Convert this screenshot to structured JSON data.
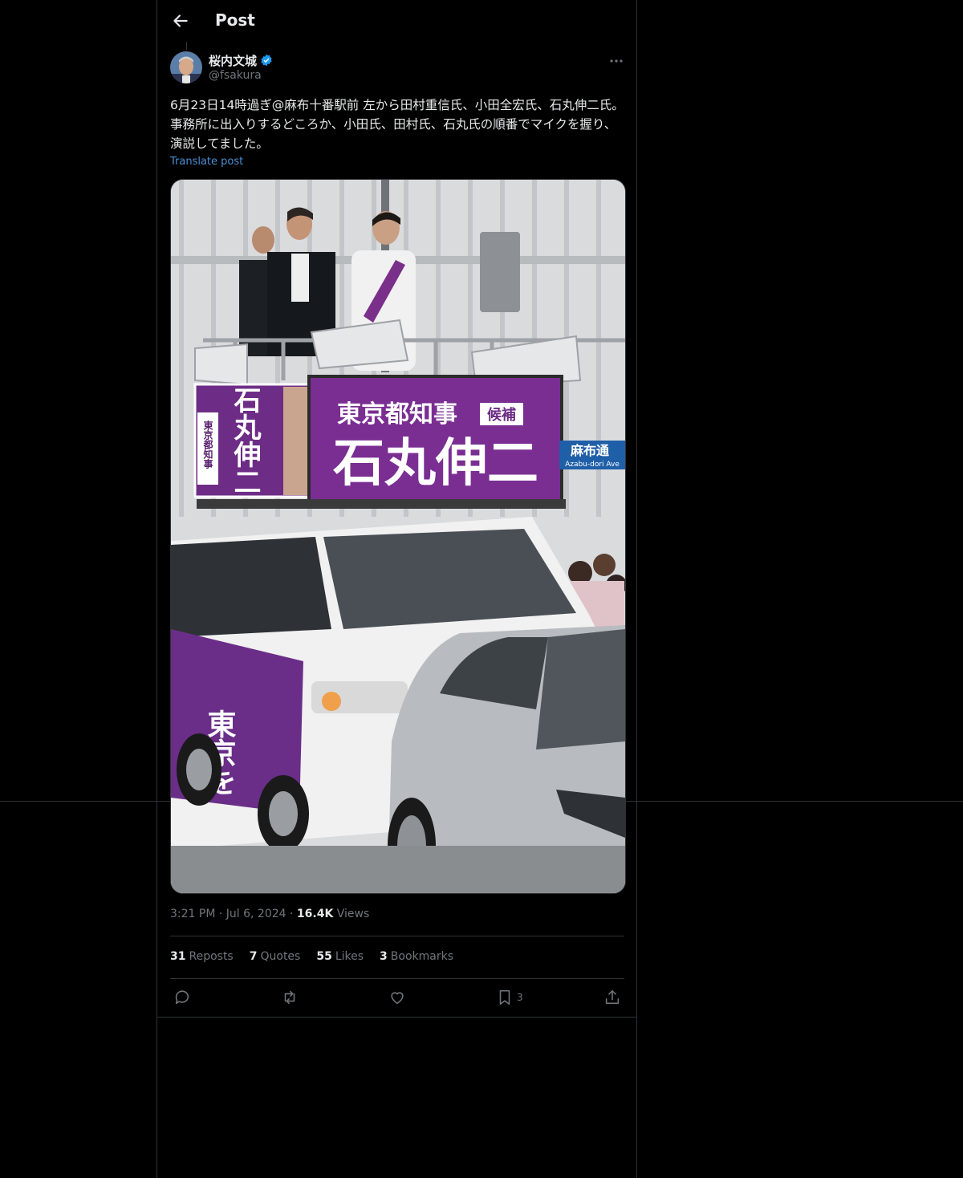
{
  "header": {
    "title": "Post",
    "back_icon": "arrow-left-icon"
  },
  "author": {
    "name": "桜内文城",
    "handle": "@fsakura",
    "verified_color": "#1d9bf0"
  },
  "post": {
    "text": "6月23日14時過ぎ@麻布十番駅前 左から田村重信氏、小田全宏氏、石丸伸二氏。 事務所に出入りするどころか、小田氏、田村氏、石丸氏の順番でマイクを握り、演説してました。",
    "translate_label": "Translate post"
  },
  "image": {
    "banner_main": "石丸伸二",
    "banner_top": "東京都知事",
    "banner_tag": "候補",
    "side_banner": "石丸伸二",
    "side_small": "東京都知事",
    "street_sign": "麻布通",
    "street_sign_en": "Azabu-dori Ave",
    "van_text": "東京を"
  },
  "meta": {
    "time": "3:21 PM",
    "dot1": "·",
    "date": "Jul 6, 2024",
    "dot2": "·",
    "views": "16.4K",
    "views_label": "Views"
  },
  "stats": {
    "reposts": "31",
    "reposts_label": "Reposts",
    "quotes": "7",
    "quotes_label": "Quotes",
    "likes": "55",
    "likes_label": "Likes",
    "bookmarks": "3",
    "bookmarks_label": "Bookmarks"
  },
  "actions": {
    "bookmark_count": "3"
  }
}
